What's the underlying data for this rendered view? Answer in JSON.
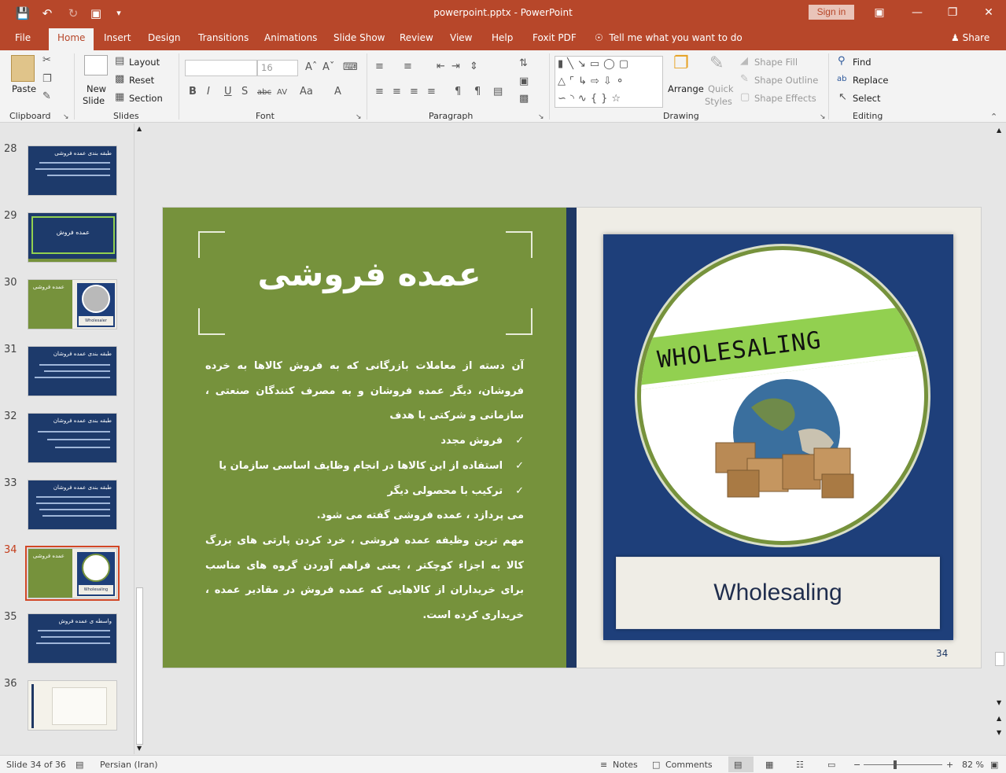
{
  "window": {
    "title": "powerpoint.pptx  -  PowerPoint",
    "signin_label": "Sign in"
  },
  "tabs": [
    "File",
    "Home",
    "Insert",
    "Design",
    "Transitions",
    "Animations",
    "Slide Show",
    "Review",
    "View",
    "Help",
    "Foxit PDF"
  ],
  "tellme": "Tell me what you want to do",
  "share": "Share",
  "ribbon": {
    "clipboard": {
      "label": "Clipboard",
      "paste": "Paste"
    },
    "slides": {
      "label": "Slides",
      "new_slide_1": "New",
      "new_slide_2": "Slide",
      "layout": "Layout",
      "reset": "Reset",
      "section": "Section"
    },
    "font": {
      "label": "Font",
      "size": "16"
    },
    "paragraph": {
      "label": "Paragraph"
    },
    "drawing": {
      "label": "Drawing",
      "arrange": "Arrange",
      "quick_1": "Quick",
      "quick_2": "Styles",
      "shape_fill": "Shape Fill",
      "shape_outline": "Shape Outline",
      "shape_effects": "Shape Effects"
    },
    "editing": {
      "label": "Editing",
      "find": "Find",
      "replace": "Replace",
      "select": "Select"
    }
  },
  "thumbnails": [
    {
      "num": "28",
      "title": "طبقه بندی عمده فروشی"
    },
    {
      "num": "29",
      "title": "عمده فروش"
    },
    {
      "num": "30",
      "title": "عمده فروشی",
      "caption": "Wholesaler"
    },
    {
      "num": "31",
      "title": "طبقه بندی عمده فروشان"
    },
    {
      "num": "32",
      "title": "طبقه بندی عمده فروشان"
    },
    {
      "num": "33",
      "title": "طبقه بندی عمده فروشان"
    },
    {
      "num": "34",
      "title": "عمده فروشی",
      "caption": "Wholesaling"
    },
    {
      "num": "35",
      "title": "واسطه ی عمده فروش"
    },
    {
      "num": "36",
      "title": ""
    }
  ],
  "slide": {
    "title": "عمده فروشی",
    "para1": "آن دسته از معاملات بازرگانی که به فروش کالاها به خرده فروشان، دیگر عمده فروشان و به مصرف کنندگان صنعتی ، سازمانی و شرکتی با هدف",
    "bullets": [
      "فروش مجدد",
      "استفاده از این کالاها در انجام وظایف اساسی سازمان یا",
      "ترکیب با محصولی دیگر"
    ],
    "para2": "می پردازد ، عمده فروشی گفته می شود.",
    "para3": "مهم ترین وظیفه عمده فروشی ، خرد کردن پارتی های بزرگ کالا به اجزاء کوچکتر ، یعنی فراهم آوردن گروه های مناسب برای خریداران از کالاهایی که عمده فروش در مقادیر عمده ، خریداری کرده است.",
    "banner": "WHOLESALING",
    "caption": "Wholesaling",
    "number": "34"
  },
  "status": {
    "slide_info": "Slide 34 of 36",
    "language": "Persian (Iran)",
    "notes": "Notes",
    "comments": "Comments",
    "zoom": "82 %"
  },
  "colors": {
    "accent": "#b7472a",
    "slide_green": "#76923c",
    "slide_blue": "#1f3864",
    "banner_green": "#92d050"
  }
}
